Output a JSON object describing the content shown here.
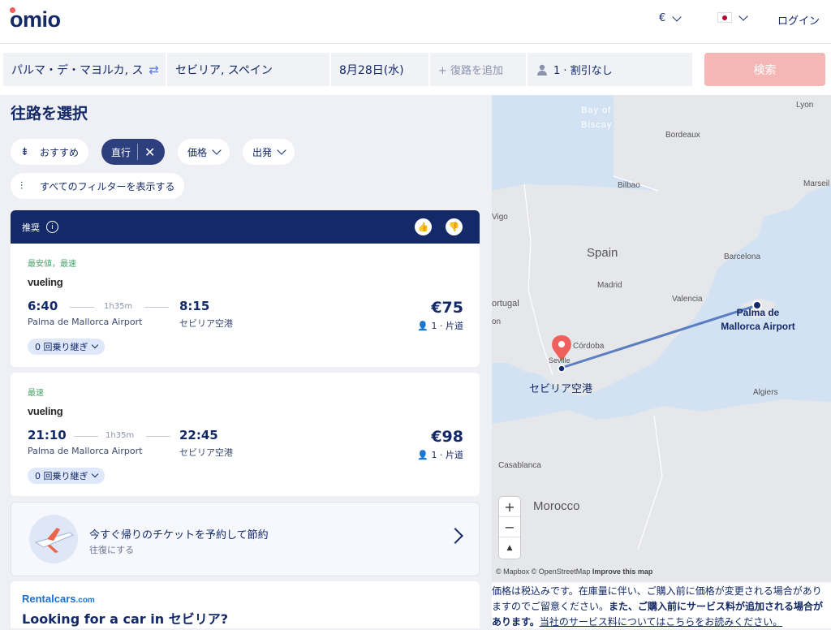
{
  "header": {
    "logo": "omio",
    "currency": "€",
    "login": "ログイン"
  },
  "search": {
    "origin": "パルマ・デ・マヨルカ, ス",
    "destination": "セビリア, スペイン",
    "date": "8月28日(水)",
    "return_placeholder": "+ 復路を追加",
    "passengers": "1 · 割引なし",
    "search_label": "検索"
  },
  "page_title": "往路を選択",
  "filters": {
    "recommended": "おすすめ",
    "direct": "直行",
    "price": "価格",
    "departure": "出発",
    "all_filters": "すべてのフィルターを表示する"
  },
  "recommended_label": "推奨",
  "results": [
    {
      "tag": "最安値，最速",
      "airline": "vueling",
      "dep": "6:40",
      "arr": "8:15",
      "duration": "1h35m",
      "from": "Palma de Mallorca Airport",
      "to": "セビリア空港",
      "price": "€75",
      "pax": "1 · 片道",
      "stops": "0 回乗り継ぎ"
    },
    {
      "tag": "最速",
      "airline": "vueling",
      "dep": "21:10",
      "arr": "22:45",
      "duration": "1h35m",
      "from": "Palma de Mallorca Airport",
      "to": "セビリア空港",
      "price": "€98",
      "pax": "1 · 片道",
      "stops": "0 回乗り継ぎ"
    }
  ],
  "promo": {
    "title": "今すぐ帰りのチケットを予約して節約",
    "subtitle": "往復にする"
  },
  "rental": {
    "logo_main": "Rentalcars",
    "logo_suffix": ".com",
    "title": "Looking for a car in セビリア?"
  },
  "map": {
    "labels": {
      "bay": "Bay of Biscay",
      "lyon": "Lyon",
      "bordeaux": "Bordeaux",
      "bilbao": "Bilbao",
      "marseille": "Marseil",
      "vigo": "Vigo",
      "spain": "Spain",
      "barcelona": "Barcelona",
      "madrid": "Madrid",
      "valencia": "Valencia",
      "portugal": "ortugal",
      "lisbon": "on",
      "cordoba": "Córdoba",
      "seville": "Seville",
      "algiers": "Algiers",
      "casablanca": "Casablanca",
      "morocco": "Morocco",
      "origin_airport": "Palma de Mallorca Airport",
      "dest_airport": "セビリア空港"
    },
    "zoom_in": "+",
    "zoom_out": "−",
    "compass": "▲",
    "attribution": "© Mapbox © OpenStreetMap",
    "improve": "Improve this map"
  },
  "disclaimer": {
    "part1": "価格は税込みです。在庫量に伴い、ご購入前に価格が変更される場合がありますのでご留意ください。",
    "part2": "また、ご購入前にサービス料が追加される場合があります。",
    "link": "当社のサービス料についてはこちらをお読みください。"
  }
}
